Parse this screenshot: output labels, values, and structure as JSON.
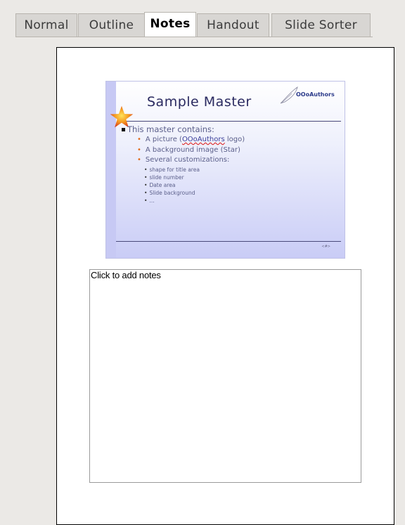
{
  "tabs": [
    {
      "label": "Normal",
      "active": false
    },
    {
      "label": "Outline",
      "active": false
    },
    {
      "label": "Notes",
      "active": true
    },
    {
      "label": "Handout",
      "active": false
    },
    {
      "label": "Slide Sorter",
      "active": false
    }
  ],
  "slide": {
    "title": "Sample Master",
    "logo_text": "OOoAuthors",
    "level1": "This master contains:",
    "level2": {
      "picture_prefix": "A picture (",
      "picture_link": "OOoAuthors",
      "picture_suffix": " logo)",
      "background": "A background image (Star)",
      "customizations": "Several customizations:"
    },
    "level3": [
      "shape for title area",
      "slide number",
      "Date area",
      "Slide background",
      "..."
    ]
  },
  "notes": {
    "placeholder": "Click to add notes"
  },
  "colors": {
    "slide_title": "#2a2a60",
    "bullet_orange": "#e06a1a",
    "active_tab": "#ffffff"
  }
}
